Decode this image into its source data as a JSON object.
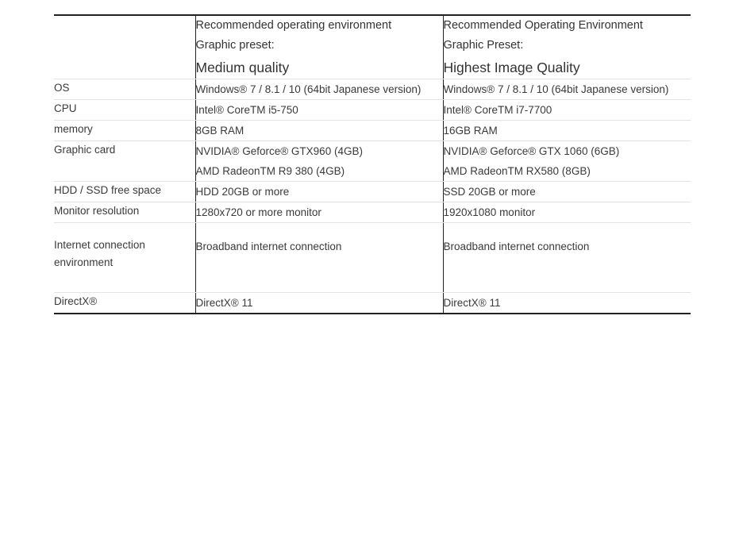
{
  "table": {
    "header": {
      "label_column": "",
      "columns": [
        {
          "line1": "Recommended operating environment",
          "line2": "Graphic preset:",
          "preset": "Medium quality"
        },
        {
          "line1": "Recommended Operating Environment",
          "line2": "Graphic Preset:",
          "preset": "Highest Image Quality"
        }
      ]
    },
    "rows": [
      {
        "label": [
          "OS"
        ],
        "medium": [
          "Windows® 7 / 8.1 / 10 (64bit Japanese version)"
        ],
        "highest": [
          "Windows® 7 / 8.1 / 10 (64bit Japanese version)"
        ]
      },
      {
        "label": [
          "CPU"
        ],
        "medium": [
          "Intel® CoreTM i5-750"
        ],
        "highest": [
          "Intel® CoreTM i7-7700"
        ]
      },
      {
        "label": [
          "memory"
        ],
        "medium": [
          "8GB RAM"
        ],
        "highest": [
          "16GB RAM"
        ]
      },
      {
        "label": [
          "Graphic card"
        ],
        "medium": [
          "NVIDIA® Geforce® GTX960 (4GB)",
          "AMD RadeonTM R9 380 (4GB)"
        ],
        "highest": [
          "NVIDIA® Geforce® GTX 1060 (6GB)",
          "AMD RadeonTM RX580 (8GB)"
        ]
      },
      {
        "label": [
          "HDD / SSD free space"
        ],
        "medium": [
          "HDD 20GB or more"
        ],
        "highest": [
          "SSD 20GB or more"
        ]
      },
      {
        "label": [
          "Monitor resolution"
        ],
        "medium": [
          "1280x720 or more monitor"
        ],
        "highest": [
          "1920x1080 monitor"
        ]
      },
      {
        "label": [
          "Internet connection",
          "environment"
        ],
        "medium": [
          "Broadband internet connection"
        ],
        "highest": [
          "Broadband internet connection"
        ]
      },
      {
        "label": [
          "DirectX®"
        ],
        "medium": [
          "DirectX® 11"
        ],
        "highest": [
          "DirectX® 11"
        ]
      }
    ]
  },
  "colors": {
    "text": "#333333",
    "border_strong": "#222222",
    "border_light": "#e3e3e3",
    "background": "#ffffff"
  }
}
